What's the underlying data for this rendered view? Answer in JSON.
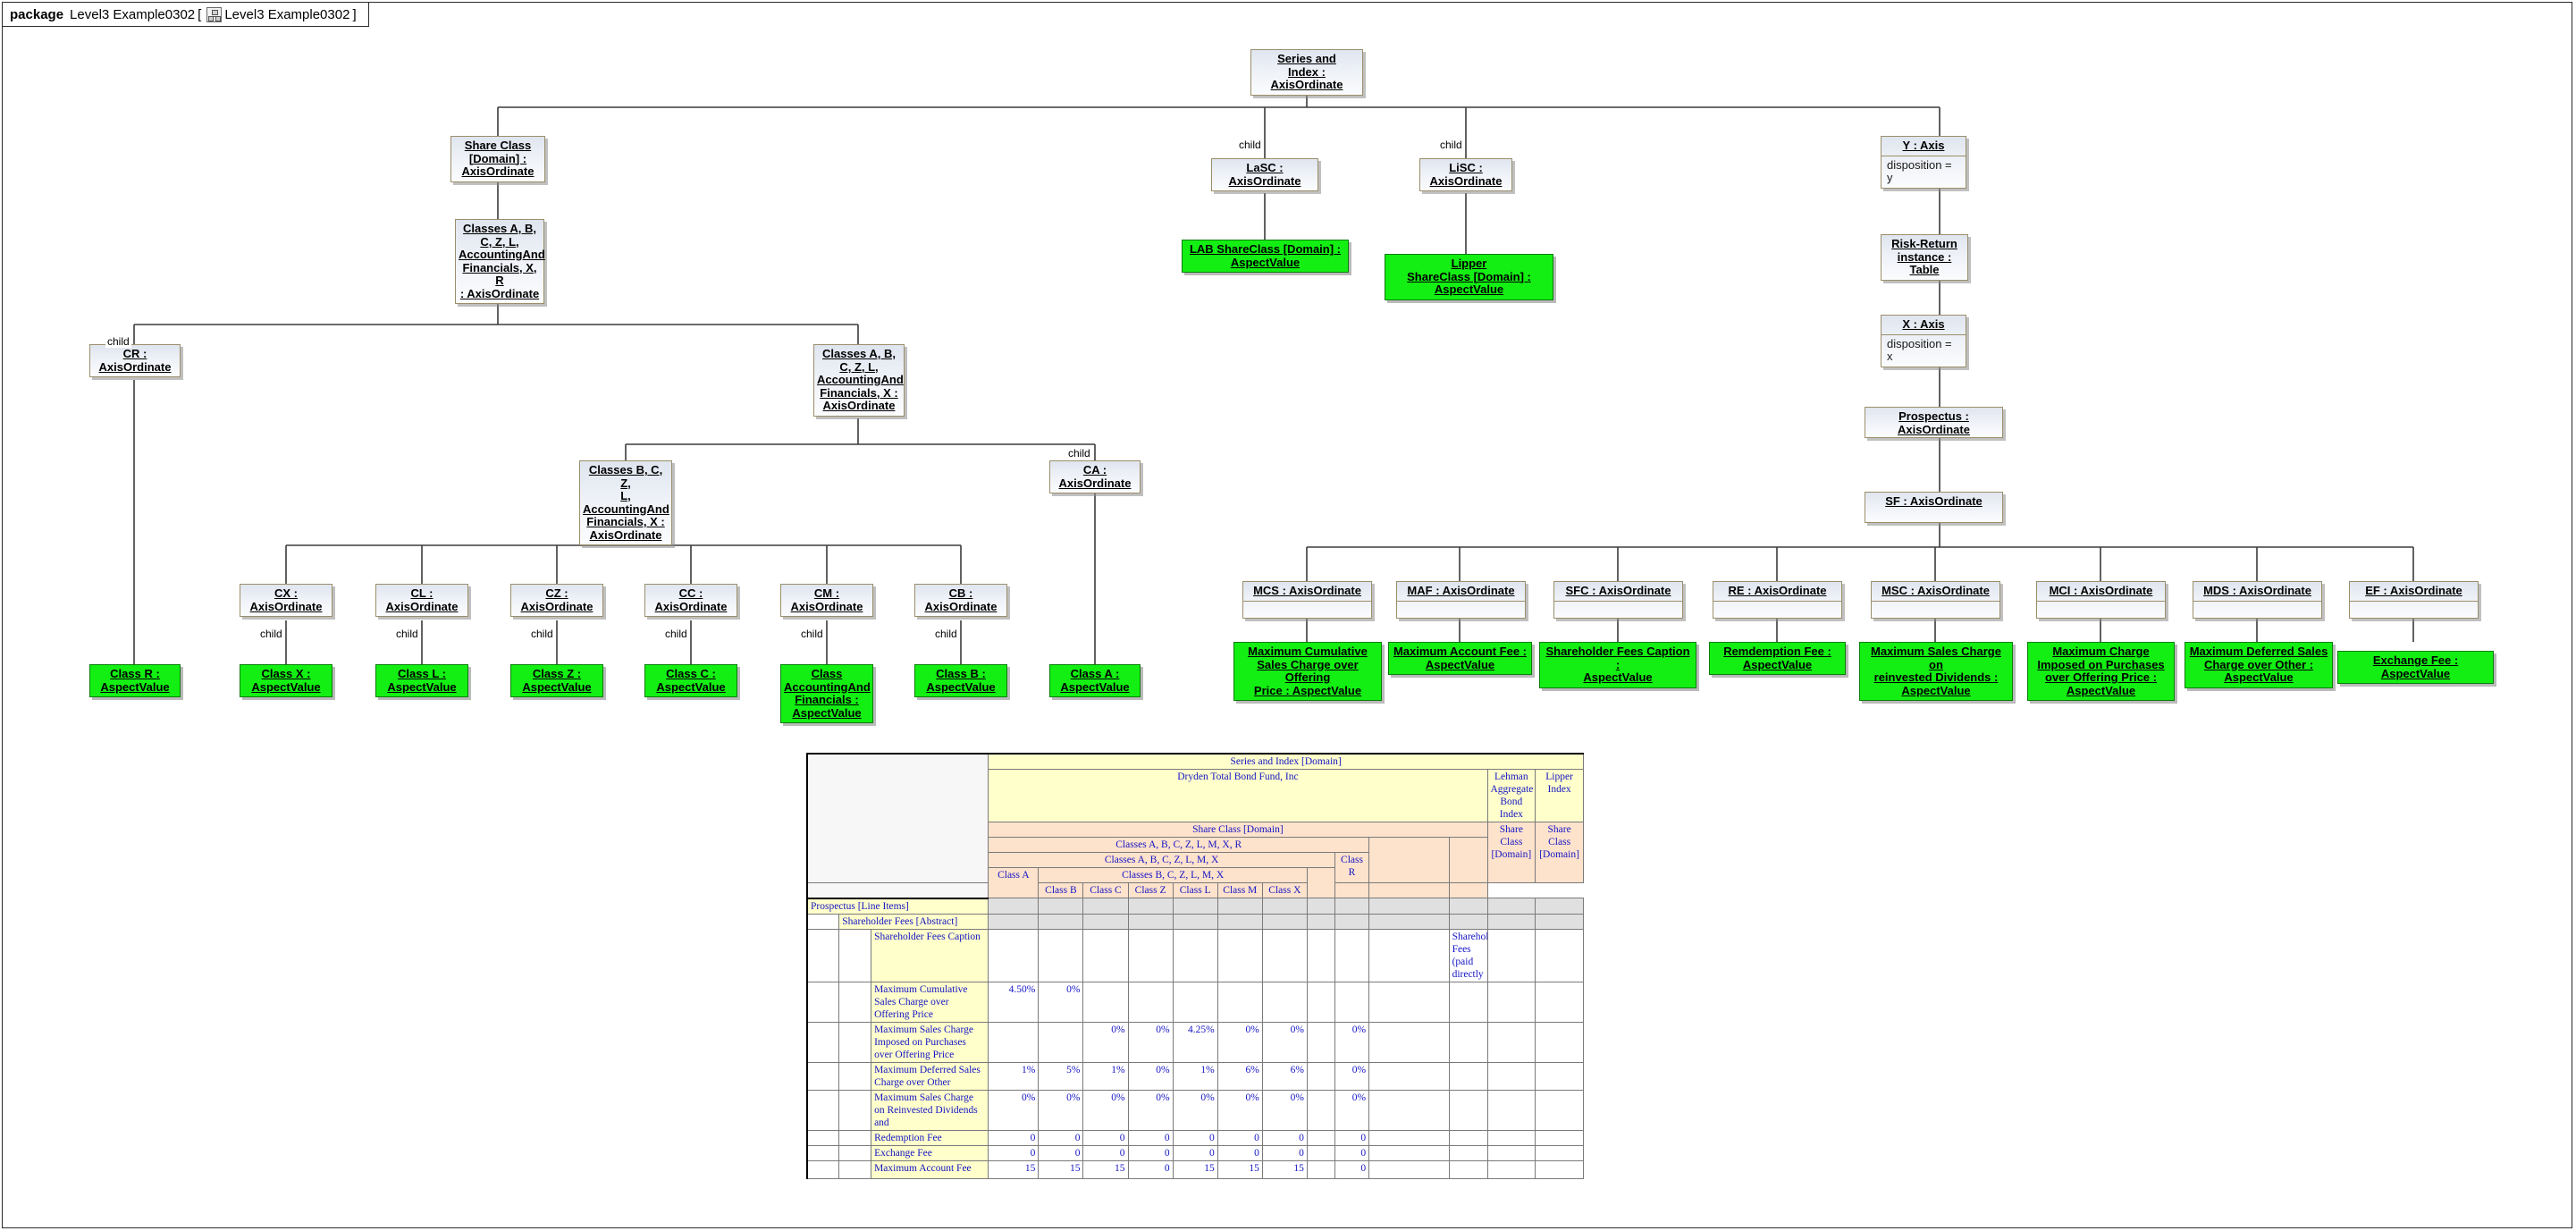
{
  "package": {
    "keyword": "package",
    "name": "Level3 Example0302",
    "bracket_open": "[",
    "icon": "package-diagram-icon",
    "inner_name": "Level3 Example0302",
    "bracket_close": "]"
  },
  "diagram": {
    "edge_label_child": "child",
    "nodes": {
      "series_index": "Series and\nIndex :\nAxisOrdinate",
      "share_class_domain": "Share Class\n[Domain] :\nAxisOrdinate",
      "classes_abczl_xr": "Classes A, B,\nC, Z, L,\nAccountingAnd\nFinancials, X, R\n: AxisOrdinate",
      "cr": "CR :\nAxisOrdinate",
      "classes_abczl_x": "Classes A, B,\nC, Z, L,\nAccountingAnd\nFinancials, X :\nAxisOrdinate",
      "classes_bczl_x": "Classes B, C, Z,\nL,\nAccountingAnd\nFinancials, X :\nAxisOrdinate",
      "ca": "CA :\nAxisOrdinate",
      "cx": "CX :\nAxisOrdinate",
      "cl": "CL :\nAxisOrdinate",
      "cz": "CZ :\nAxisOrdinate",
      "cc": "CC :\nAxisOrdinate",
      "cm": "CM :\nAxisOrdinate",
      "cb": "CB :\nAxisOrdinate",
      "lasc": "LaSC :\nAxisOrdinate",
      "lisc": "LiSC :\nAxisOrdinate",
      "y_axis": "Y : Axis",
      "y_axis_attr": "disposition = y",
      "risk_return": "Risk-Return\ninstance : Table",
      "x_axis": "X : Axis",
      "x_axis_attr": "disposition = x",
      "prospectus": "Prospectus : AxisOrdinate",
      "sf": "SF : AxisOrdinate",
      "mcs": "MCS : AxisOrdinate",
      "maf": "MAF : AxisOrdinate",
      "sfc": "SFC : AxisOrdinate",
      "re": "RE : AxisOrdinate",
      "msc": "MSC : AxisOrdinate",
      "mci": "MCI : AxisOrdinate",
      "mds": "MDS : AxisOrdinate",
      "ef": "EF : AxisOrdinate"
    },
    "green_nodes": {
      "class_r": "Class R :\nAspectValue",
      "class_x": "Class X :\nAspectValue",
      "class_l": "Class L :\nAspectValue",
      "class_z": "Class Z :\nAspectValue",
      "class_c": "Class C :\nAspectValue",
      "class_acf": "Class\nAccountingAnd\nFinancials :\nAspectValue",
      "class_b": "Class B :\nAspectValue",
      "class_a": "Class A :\nAspectValue",
      "lab_shareclass": "LAB ShareClass [Domain] :\nAspectValue",
      "lipper_shareclass": "Lipper\nShareClass [Domain] :\nAspectValue",
      "max_cum_sales": "Maximum Cumulative\nSales Charge over Offering\nPrice : AspectValue",
      "max_account_fee": "Maximum Account Fee :\nAspectValue",
      "shareholder_fees_caption": "Shareholder Fees Caption :\nAspectValue",
      "redemption_fee": "Remdemption Fee :\nAspectValue",
      "max_sales_reinvested": "Maximum Sales Charge on\nreinvested Dividends :\nAspectValue",
      "max_charge_purchases": "Maximum Charge\nImposed on Purchases\nover Offering Price :\nAspectValue",
      "max_deferred_sales": "Maximum Deferred Sales\nCharge over Other :\nAspectValue",
      "exchange_fee": "Exchange Fee : AspectValue"
    }
  },
  "table": {
    "headers": {
      "series_and_index_domain": "Series and Index [Domain]",
      "dryden": "Dryden Total Bond Fund, Inc",
      "lehman": "Lehman Aggregate Bond Index",
      "lipper": "Lipper Index",
      "share_class_domain": "Share Class [Domain]",
      "share_class_domain_lehman": "Share Class [Domain]",
      "share_class_domain_lipper": "Share Class [Domain]",
      "classes_abczlmxr": "Classes A, B, C, Z, L, M, X, R",
      "classes_abczlmx": "Classes A, B, C, Z, L, M, X",
      "class_r": "Class R",
      "class_a": "Class A",
      "classes_bczlmx": "Classes B, C, Z, L, M, X",
      "leaf_classes": [
        "Class B",
        "Class C",
        "Class Z",
        "Class L",
        "Class M",
        "Class X"
      ]
    },
    "rows": [
      {
        "label": "Prospectus [Line Items]",
        "indent": 0,
        "style": "grey",
        "values": [
          "",
          "",
          "",
          "",
          "",
          "",
          "",
          "",
          "",
          "",
          "",
          ""
        ]
      },
      {
        "label": "Shareholder Fees [Abstract]",
        "indent": 1,
        "style": "grey",
        "values": [
          "",
          "",
          "",
          "",
          "",
          "",
          "",
          "",
          "",
          "",
          "",
          ""
        ]
      },
      {
        "label": "Shareholder Fees Caption",
        "indent": 2,
        "style": "text",
        "values": [
          "",
          "",
          "",
          "",
          "",
          "",
          "",
          "",
          "",
          "Shareholder Fees (paid directly",
          "",
          ""
        ]
      },
      {
        "label": "Maximum Cumulative Sales Charge over Offering Price",
        "indent": 2,
        "style": "num",
        "values": [
          "4.50%",
          "0%",
          "",
          "",
          "",
          "",
          "",
          "",
          "",
          "",
          "",
          ""
        ]
      },
      {
        "label": "Maximum Sales Charge Imposed on Purchases over Offering Price",
        "indent": 2,
        "style": "num",
        "values": [
          "",
          "",
          "0%",
          "0%",
          "4.25%",
          "0%",
          "0%",
          "",
          "0%",
          "",
          "",
          ""
        ]
      },
      {
        "label": "Maximum Deferred Sales Charge over Other",
        "indent": 2,
        "style": "num",
        "values": [
          "1%",
          "5%",
          "1%",
          "0%",
          "1%",
          "6%",
          "6%",
          "",
          "0%",
          "",
          "",
          ""
        ]
      },
      {
        "label": "Maximum Sales Charge on Reinvested Dividends and",
        "indent": 2,
        "style": "num",
        "values": [
          "0%",
          "0%",
          "0%",
          "0%",
          "0%",
          "0%",
          "0%",
          "",
          "0%",
          "",
          "",
          ""
        ]
      },
      {
        "label": "Redemption Fee",
        "indent": 2,
        "style": "num",
        "values": [
          "0",
          "0",
          "0",
          "0",
          "0",
          "0",
          "0",
          "",
          "0",
          "",
          "",
          ""
        ]
      },
      {
        "label": "Exchange Fee",
        "indent": 2,
        "style": "num",
        "values": [
          "0",
          "0",
          "0",
          "0",
          "0",
          "0",
          "0",
          "",
          "0",
          "",
          "",
          ""
        ]
      },
      {
        "label": "Maximum Account Fee",
        "indent": 2,
        "style": "num",
        "values": [
          "15",
          "15",
          "15",
          "0",
          "15",
          "15",
          "15",
          "",
          "0",
          "",
          "",
          ""
        ]
      }
    ]
  },
  "colors": {
    "node_border": "#9b8f6a",
    "green_fill": "#13ef13",
    "header_yellow": "#ffffcc",
    "header_peach": "#fde2cc",
    "row_grey": "#e0e0e0",
    "table_text": "#1515c4"
  }
}
